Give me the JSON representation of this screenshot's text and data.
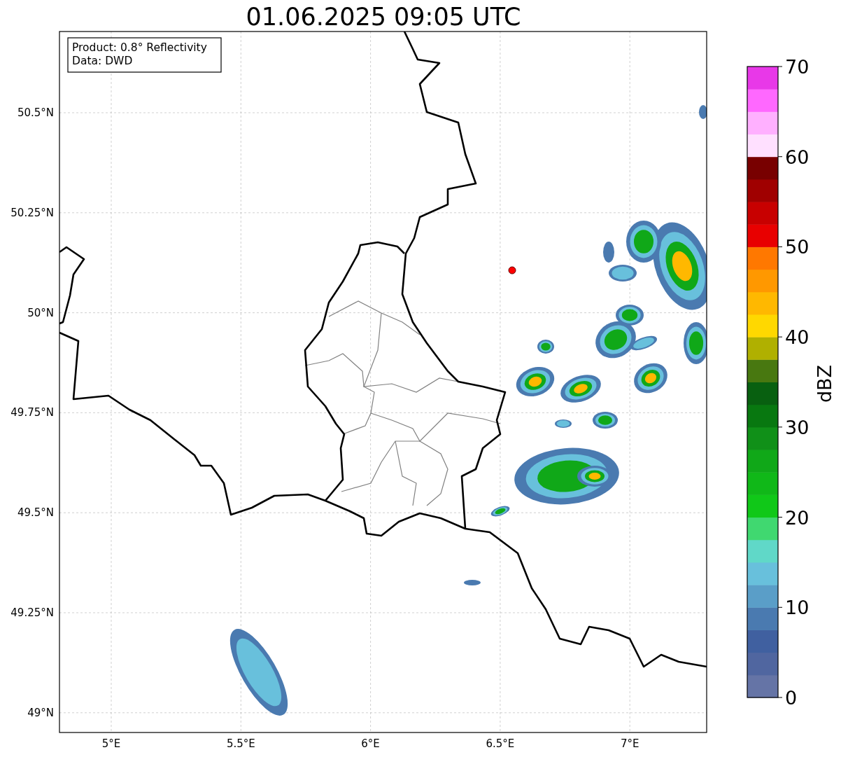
{
  "title": "01.06.2025 09:05 UTC",
  "info_box": {
    "lines": [
      "Product: 0.8° Reflectivity",
      "Data: DWD"
    ]
  },
  "map": {
    "y_ticks": [
      "50.5°N",
      "50.25°N",
      "50°N",
      "49.75°N",
      "49.5°N",
      "49.25°N",
      "49°N"
    ],
    "x_ticks": [
      "5°E",
      "5.5°E",
      "6°E",
      "6.5°E",
      "7°E"
    ]
  },
  "colorbar": {
    "label": "dBZ",
    "ticks": [
      "70",
      "60",
      "50",
      "40",
      "30",
      "20",
      "10",
      "0"
    ],
    "segments": [
      {
        "color": "#6574a6"
      },
      {
        "color": "#5066a0"
      },
      {
        "color": "#4060a0"
      },
      {
        "color": "#4a7ab0"
      },
      {
        "color": "#5a9ec8"
      },
      {
        "color": "#68c0dc"
      },
      {
        "color": "#60d8c8"
      },
      {
        "color": "#40d870"
      },
      {
        "color": "#10c818"
      },
      {
        "color": "#10b818"
      },
      {
        "color": "#10a818"
      },
      {
        "color": "#109018"
      },
      {
        "color": "#087810"
      },
      {
        "color": "#086010"
      },
      {
        "color": "#487810"
      },
      {
        "color": "#b0b000"
      },
      {
        "color": "#ffd800"
      },
      {
        "color": "#ffb800"
      },
      {
        "color": "#ff9800"
      },
      {
        "color": "#ff7800"
      },
      {
        "color": "#e80000"
      },
      {
        "color": "#c80000"
      },
      {
        "color": "#a00000"
      },
      {
        "color": "#780000"
      },
      {
        "color": "#ffe0ff"
      },
      {
        "color": "#ffb0ff"
      },
      {
        "color": "#ff68ff"
      },
      {
        "color": "#e838e8"
      }
    ]
  }
}
